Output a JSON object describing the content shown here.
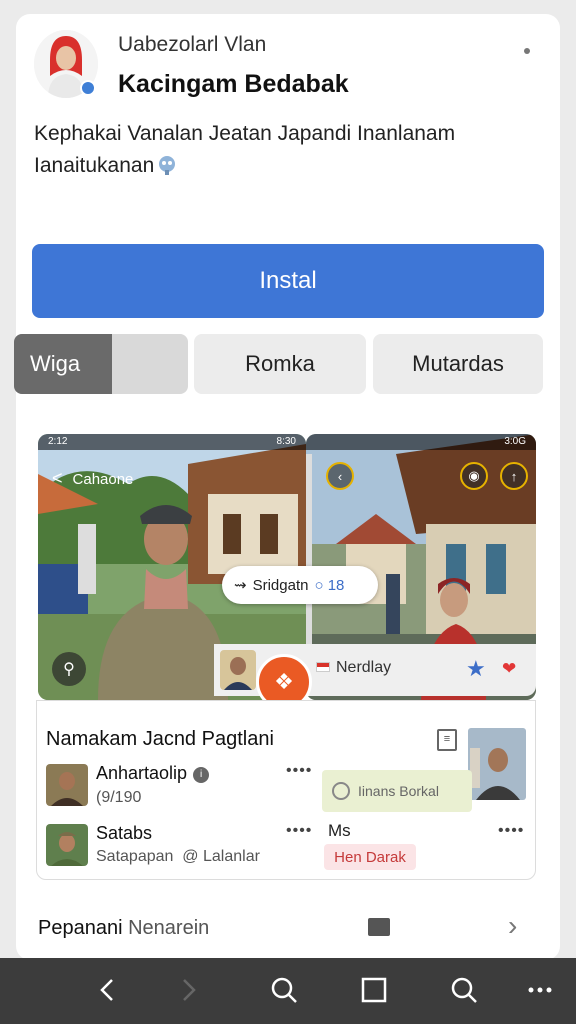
{
  "app": {
    "developer": "Uabezolarl Vlan",
    "name": "Kacingam Bedabak",
    "description_line1": "Kephakai Vanalan Jeatan Japandi Inanlanam",
    "description_line2": "Ianaitukanan"
  },
  "install": {
    "label": "Instal"
  },
  "tabs": [
    {
      "label": "Wiga",
      "active": true
    },
    {
      "label": "Romka",
      "active": false
    },
    {
      "label": "Mutardas",
      "active": false
    }
  ],
  "screenshot1": {
    "status_left": "2:12",
    "status_right": "8:30",
    "back_label": "Cahaone"
  },
  "screenshot2": {
    "status_right": "3:0G"
  },
  "chip": {
    "label": "Sridgatn",
    "count": "18"
  },
  "overlay": {
    "label": "Nerdlay"
  },
  "panel": {
    "title": "Namakam Jacnd Pagtlani",
    "rows": [
      {
        "name": "Anhartaolip",
        "sub": "(9/190"
      },
      {
        "name": "Satabs",
        "sub": "Satapapan",
        "sub2": "Lalanlar"
      }
    ],
    "green_chip": "Iinans Borkal",
    "right_label": "Ms",
    "red_badge": "Hen Darak"
  },
  "footer": {
    "label": "Pepanani",
    "label2": "Nenarein"
  },
  "colors": {
    "accent": "#3e76d6",
    "orange": "#ea5a24",
    "navbar": "#3c3c3c"
  }
}
